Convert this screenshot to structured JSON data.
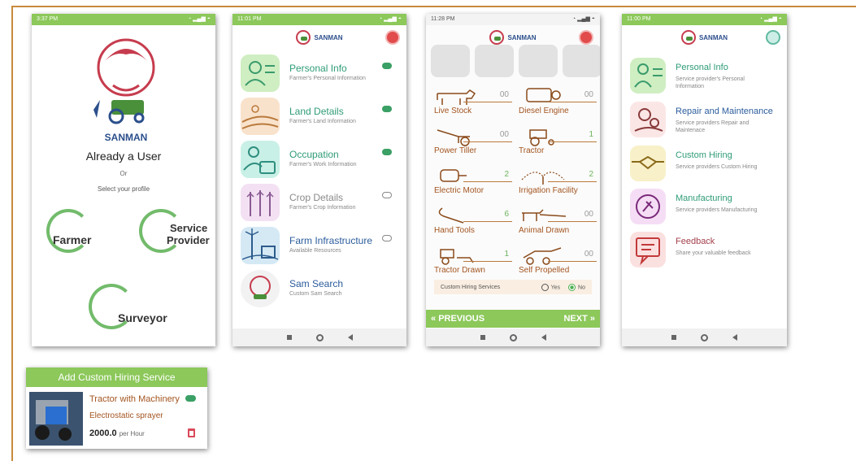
{
  "screen1": {
    "status_time": "3:37 PM",
    "brand": "SANMAN",
    "already_user": "Already a User",
    "or_text": "Or",
    "select_profile": "Select your profile",
    "farmer": "Farmer",
    "service": "Service",
    "provider": "Provider",
    "surveyor": "Surveyor"
  },
  "screen2": {
    "status_time": "11:01 PM",
    "brand": "SANMAN",
    "items": [
      {
        "title": "Personal Info",
        "sub": "Farmer's Personal Information",
        "synced": true
      },
      {
        "title": "Land Details",
        "sub": "Farmer's Land Information",
        "synced": true
      },
      {
        "title": "Occupation",
        "sub": "Farmer's Work Information",
        "synced": true
      },
      {
        "title": "Crop Details",
        "sub": "Farmer's Crop Information",
        "synced": false
      },
      {
        "title": "Farm Infrastructure",
        "sub": "Available Resources",
        "synced": false
      },
      {
        "title": "Sam Search",
        "sub": "Custom Sam Search",
        "synced": null
      }
    ]
  },
  "screen3": {
    "status_time": "11:28 PM",
    "brand": "SANMAN",
    "equipment": [
      {
        "name": "Live Stock",
        "count": "00"
      },
      {
        "name": "Diesel Engine",
        "count": "00"
      },
      {
        "name": "Power Tiller",
        "count": "00"
      },
      {
        "name": "Tractor",
        "count": "1"
      },
      {
        "name": "Electric Motor",
        "count": "2"
      },
      {
        "name": "Irrigation Facility",
        "count": "2"
      },
      {
        "name": "Hand Tools",
        "count": "6"
      },
      {
        "name": "Animal Drawn",
        "count": "00"
      },
      {
        "name": "Tractor Drawn",
        "count": "1"
      },
      {
        "name": "Self Propelled",
        "count": "00"
      }
    ],
    "custom_hiring_label": "Custom Hiring Services",
    "yes": "Yes",
    "no": "No",
    "previous": "PREVIOUS",
    "next": "NEXT"
  },
  "screen4": {
    "status_time": "11:00 PM",
    "brand": "SANMAN",
    "items": [
      {
        "title": "Personal Info",
        "sub": "Service provider's Personal Information"
      },
      {
        "title": "Repair and Maintenance",
        "sub": "Service providers Repair and Maintenace"
      },
      {
        "title": "Custom Hiring",
        "sub": "Service providers Custom Hiring"
      },
      {
        "title": "Manufacturing",
        "sub": "Service providers Manufacturing"
      },
      {
        "title": "Feedback",
        "sub": "Share your valuable feedback"
      }
    ]
  },
  "card": {
    "header": "Add Custom Hiring Service",
    "title": "Tractor with Machinery",
    "subtitle": "Electrostatic sprayer",
    "price": "2000.0",
    "unit": "per Hour"
  },
  "colors": {
    "accent_green": "#8cc85a",
    "title_green": "#2f9c78",
    "brown": "#a3541f",
    "frame": "#c98a3c"
  }
}
